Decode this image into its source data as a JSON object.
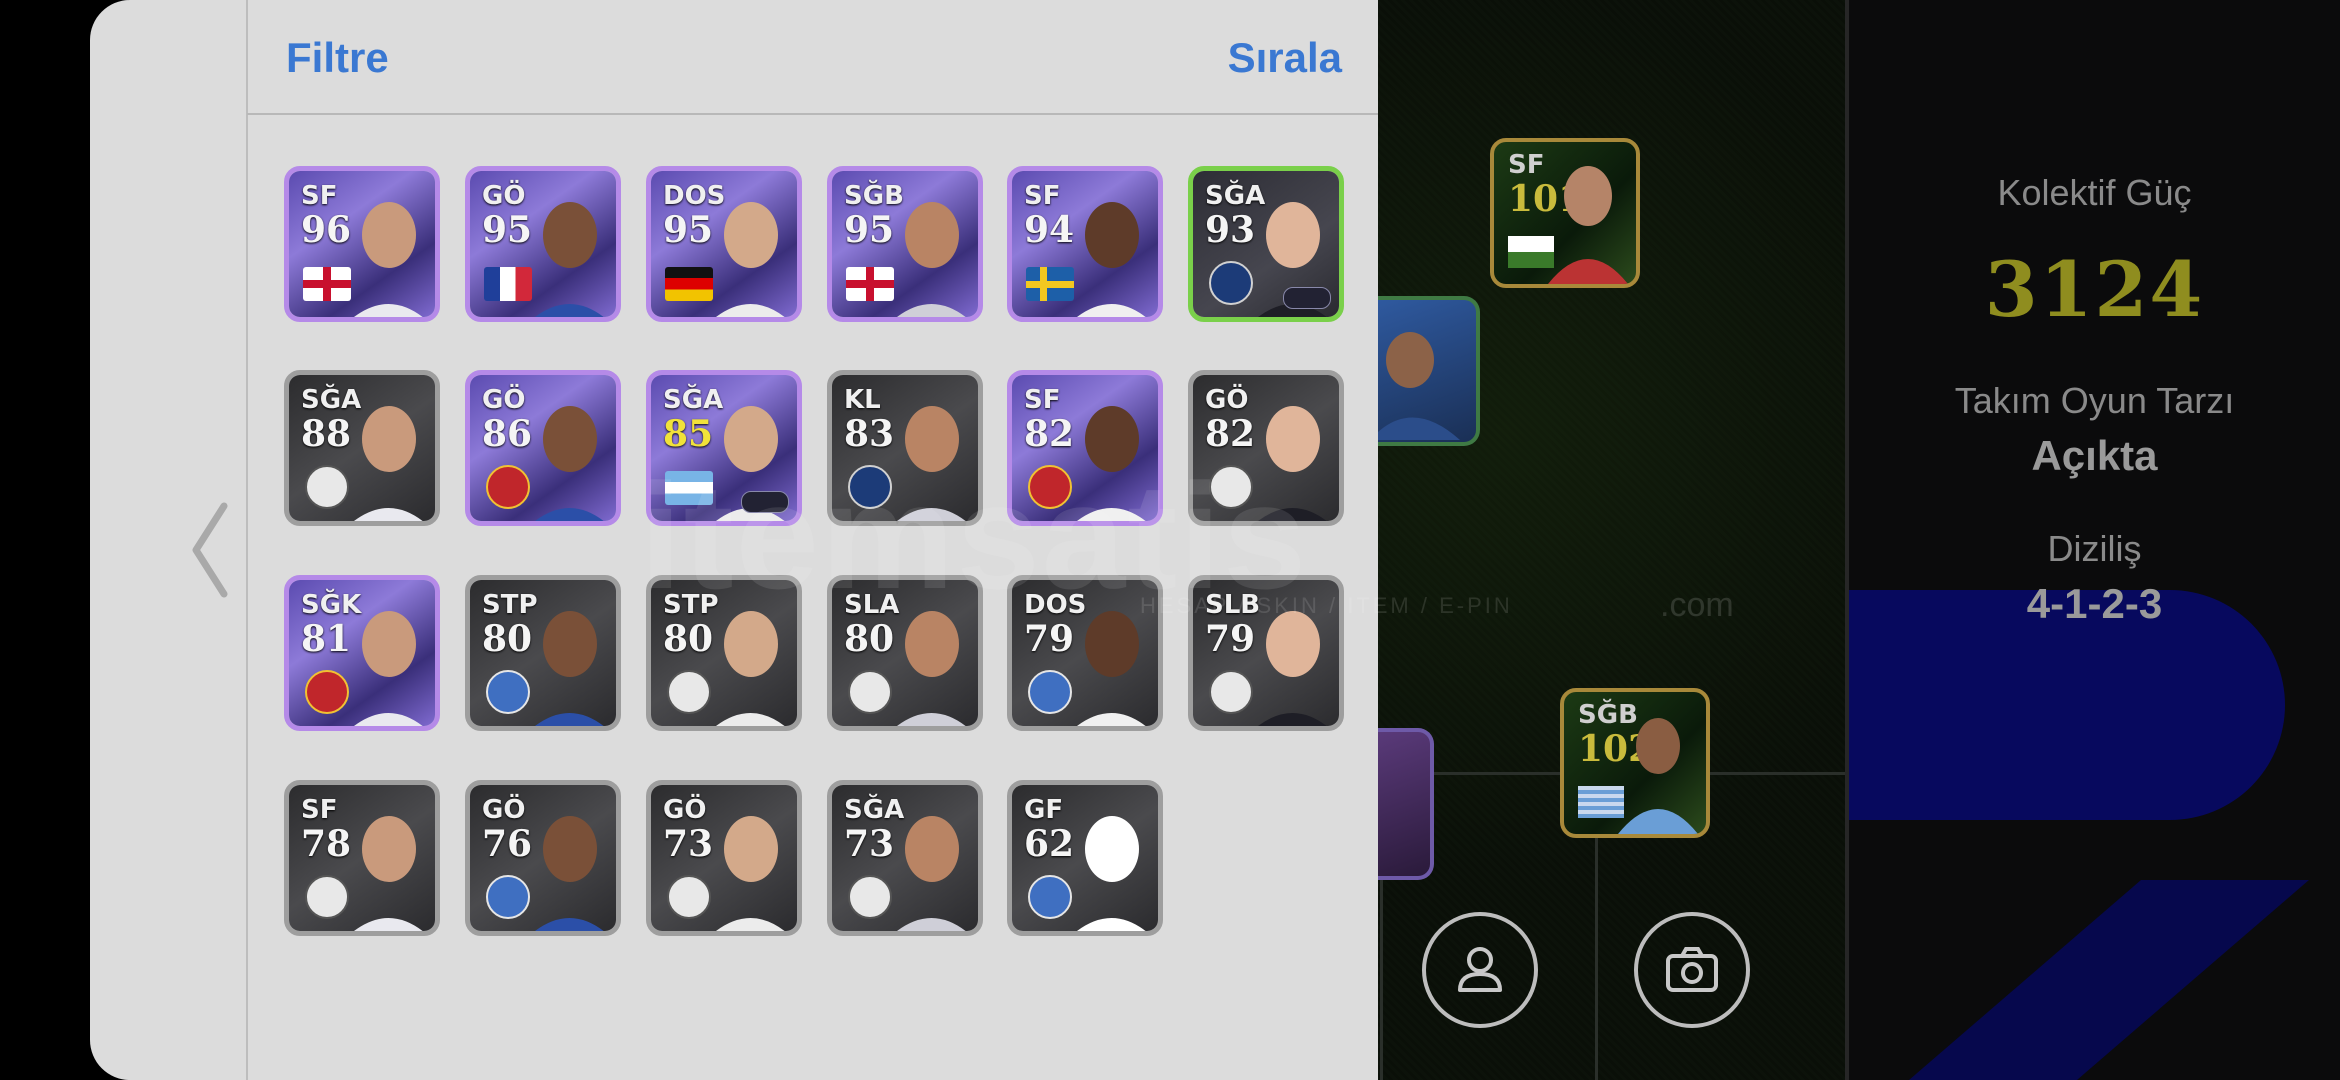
{
  "header": {
    "filter_label": "Filtre",
    "sort_label": "Sırala"
  },
  "team_info": {
    "power_label": "Kolektif Güç",
    "power_value": "3124",
    "style_label": "Takım Oyun Tarzı",
    "style_value": "Açıkta",
    "formation_label": "Diziliş",
    "formation_value": "4-1-2-3"
  },
  "watermark": {
    "brand": "itemsatis",
    "sub": "HESAP / SKIN / ITEM / E-PIN",
    "domain": ".com"
  },
  "pitch_cards": [
    {
      "position": "SF",
      "rating": "101"
    },
    {
      "position": "SĞB",
      "rating": "102"
    }
  ],
  "players": [
    {
      "position": "SF",
      "rating": "96",
      "nation": "england",
      "style": "purple"
    },
    {
      "position": "GÖ",
      "rating": "95",
      "nation": "france",
      "style": "purple"
    },
    {
      "position": "DOS",
      "rating": "95",
      "nation": "germany",
      "style": "purple"
    },
    {
      "position": "SĞB",
      "rating": "95",
      "nation": "england",
      "style": "purple"
    },
    {
      "position": "SF",
      "rating": "94",
      "nation": "sweden",
      "style": "purple"
    },
    {
      "position": "SĞA",
      "rating": "93",
      "nation": "psg-crest",
      "style": "green"
    },
    {
      "position": "SĞA",
      "rating": "88",
      "nation": "club-crest",
      "style": "gray"
    },
    {
      "position": "GÖ",
      "rating": "86",
      "nation": "arsenal-crest",
      "style": "purple"
    },
    {
      "position": "SĞA",
      "rating": "85",
      "nation": "argentina",
      "style": "purple"
    },
    {
      "position": "KL",
      "rating": "83",
      "nation": "psg-crest",
      "style": "gray"
    },
    {
      "position": "SF",
      "rating": "82",
      "nation": "manutd-crest",
      "style": "purple"
    },
    {
      "position": "GÖ",
      "rating": "82",
      "nation": "club-crest",
      "style": "gray"
    },
    {
      "position": "SĞK",
      "rating": "81",
      "nation": "manutd-crest",
      "style": "purple"
    },
    {
      "position": "STP",
      "rating": "80",
      "nation": "club-crest",
      "style": "gray"
    },
    {
      "position": "STP",
      "rating": "80",
      "nation": "club-crest",
      "style": "gray"
    },
    {
      "position": "SLA",
      "rating": "80",
      "nation": "club-crest",
      "style": "gray"
    },
    {
      "position": "DOS",
      "rating": "79",
      "nation": "club-crest",
      "style": "gray"
    },
    {
      "position": "SLB",
      "rating": "79",
      "nation": "club-crest",
      "style": "gray"
    },
    {
      "position": "SF",
      "rating": "78",
      "nation": "club-crest",
      "style": "gray"
    },
    {
      "position": "GÖ",
      "rating": "76",
      "nation": "club-crest",
      "style": "gray"
    },
    {
      "position": "GÖ",
      "rating": "73",
      "nation": "club-crest",
      "style": "gray"
    },
    {
      "position": "SĞA",
      "rating": "73",
      "nation": "club-crest",
      "style": "gray"
    },
    {
      "position": "GF",
      "rating": "62",
      "nation": "club-crest",
      "style": "gray"
    }
  ],
  "icons": {
    "back": "chevron-left-icon",
    "profile": "person-icon",
    "camera": "camera-icon"
  }
}
